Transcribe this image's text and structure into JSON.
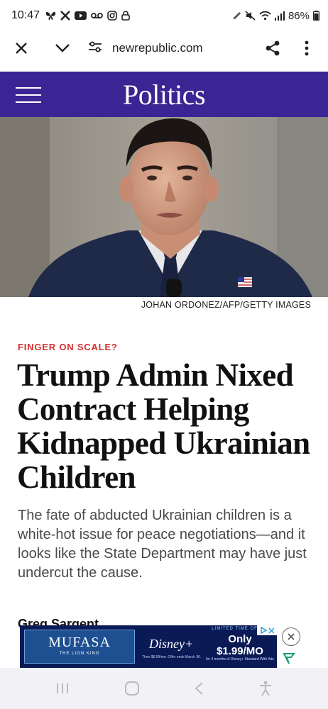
{
  "status": {
    "time": "10:47",
    "battery": "86%"
  },
  "browser": {
    "url": "newrepublic.com"
  },
  "section": {
    "title": "Politics"
  },
  "hero": {
    "credit": "JOHAN ORDONEZ/AFP/GETTY IMAGES"
  },
  "article": {
    "kicker": "FINGER ON SCALE?",
    "headline": "Trump Admin Nixed Contract Helping Kidnapped Ukrainian Children",
    "dek": "The fate of abducted Ukrainian children is a white-hot issue for peace negotiations—and it looks like the State Department may have just undercut the cause.",
    "byline": "Greg Sargent"
  },
  "ad": {
    "movie": "MUFASA",
    "movie_sub": "THE LION KING",
    "brand": "Disney+",
    "offer_label": "LIMITED TIME OFFER",
    "price": "Only $1.99/MO",
    "offer_detail": "for 4 months of Disney+ Standard With Ads",
    "fine_print": "Then $8.99/mo. Offer ends March 30."
  },
  "colors": {
    "section_bg": "#3b2493",
    "kicker": "#d62f2f"
  }
}
